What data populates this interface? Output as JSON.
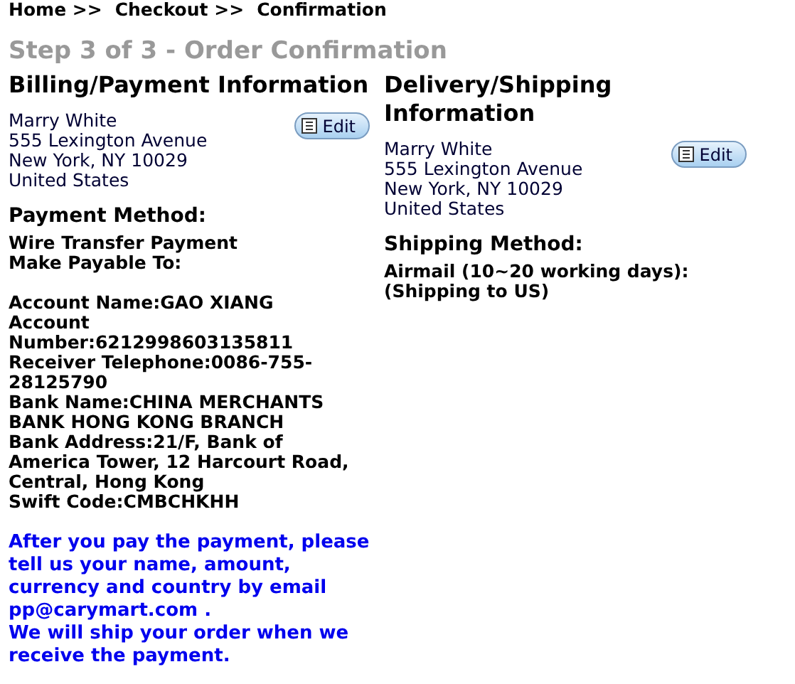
{
  "breadcrumb": [
    {
      "label": "Home >>"
    },
    {
      "label": "Checkout >>"
    },
    {
      "label": "Confirmation"
    }
  ],
  "step_title": "Step 3 of 3 - Order Confirmation",
  "billing": {
    "title": "Billing/Payment Information",
    "address": [
      "Marry White",
      "555 Lexington Avenue",
      "New York, NY 10029",
      "United States"
    ],
    "edit_button": "Edit",
    "method_title": "Payment Method:",
    "method": [
      "Wire Transfer Payment",
      "Make Payable To:"
    ],
    "account_details": [
      "Account Name:GAO XIANG",
      "Account Number:6212998603135811",
      "Receiver Telephone:0086-755-28125790",
      "Bank Name:CHINA MERCHANTS BANK HONG KONG BRANCH",
      "Bank Address:21/F, Bank of America Tower, 12 Harcourt Road, Central, Hong Kong",
      "Swift Code:CMBCHKHH"
    ],
    "note": [
      "After you pay the payment, please tell us your name, amount, currency and country by email pp@carymart.com .",
      "We will ship your order when we receive the payment."
    ]
  },
  "delivery": {
    "title": "Delivery/Shipping Information",
    "address": [
      "Marry White",
      "555 Lexington Avenue",
      "New York, NY 10029",
      "United States"
    ],
    "edit_button": "Edit",
    "method_title": "Shipping Method:",
    "method": [
      "Airmail (10~20 working days):(Shipping to US)"
    ]
  }
}
